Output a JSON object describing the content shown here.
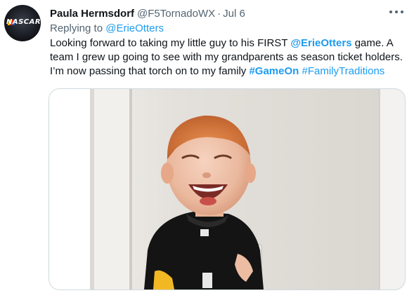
{
  "tweet": {
    "avatar": {
      "logo_text": "NASCAR"
    },
    "author_name": "Paula Hermsdorf",
    "author_handle": "@F5TornadoWX",
    "separator": "·",
    "date": "Jul 6",
    "more_icon": "more-horizontal-icon",
    "replying_to_label": "Replying to",
    "replying_to_handle": "@ErieOtters",
    "text": {
      "l1_a": "Looking forward to taking my little guy to his FIRST ",
      "l1_mention": "@ErieOtters",
      "l1_b": " game. A",
      "l2": "team I grew up going to see with my grandparents as season ticket holders.",
      "l3_a": "I’m now passing that torch on to my family ",
      "l3_hashtag1": "#GameOn",
      "l3_space": " ",
      "l3_hashtag2": "#FamilyTraditions"
    },
    "photo": {
      "subject": "toddler-photo"
    }
  },
  "colors": {
    "text_primary": "#0f1419",
    "text_secondary": "#536471",
    "link": "#1d9bf0",
    "border": "#cfd9de"
  }
}
